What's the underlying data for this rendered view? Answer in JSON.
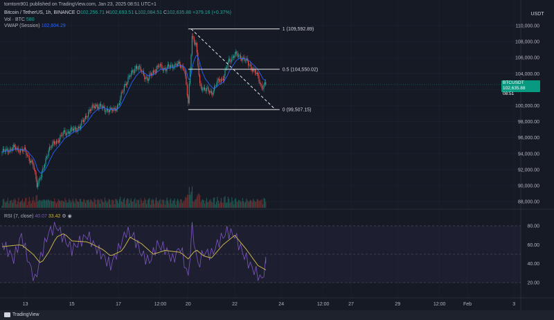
{
  "header": {
    "publisher": "tomtom901 published on TradingView.com, Jan 23, 2025 08:51 UTC+1",
    "symbol": "Bitcoin / TetherUS, 1h, BINANCE",
    "ohlc": {
      "o_label": "O",
      "o": "102,256.71",
      "h_label": "H",
      "h": "102,693.51",
      "l_label": "L",
      "l": "102,084.51",
      "c_label": "C",
      "c": "102,635.88",
      "change": "+379.16 (+0.37%)"
    },
    "vol": {
      "label": "Vol · BTC",
      "value": "580"
    },
    "vwap": {
      "label": "VWAP (Session)",
      "value": "102,604.29"
    },
    "rsi": {
      "label": "RSI (7, close)",
      "value": "40.07",
      "ma": "33.42"
    }
  },
  "currency_button": "USDT",
  "price_tag": {
    "symbol": "BTCUSDT",
    "price": "102,635.88",
    "countdown": "08:51"
  },
  "footer": {
    "brand": "TradingView"
  },
  "colors": {
    "up": "#26a69a",
    "down": "#ef5350",
    "vwap": "#2962ff",
    "rsi": "#7e57c2",
    "rsi_ma": "#c9b44a",
    "bg": "#161a25"
  },
  "chart_data": [
    {
      "type": "candlestick",
      "title": "Bitcoin / TetherUS, 1h, BINANCE",
      "ylim": [
        87000,
        111000
      ],
      "y_ticks": [
        "110,000.00",
        "108,000.00",
        "106,000.00",
        "104,000.00",
        "102,000.00",
        "100,000.00",
        "98,000.00",
        "96,000.00",
        "94,000.00",
        "92,000.00",
        "90,000.00",
        "88,000.00"
      ],
      "x_ticks": [
        "13",
        "15",
        "17",
        "12:00",
        "20",
        "22",
        "24",
        "12:00",
        "27",
        "29",
        "12:00",
        "Feb",
        "3"
      ],
      "close_path": [
        [
          "2025-01-12 00:00",
          94200
        ],
        [
          "2025-01-12 12:00",
          94700
        ],
        [
          "2025-01-13 00:00",
          94300
        ],
        [
          "2025-01-13 08:00",
          92500
        ],
        [
          "2025-01-13 12:00",
          90200
        ],
        [
          "2025-01-13 18:00",
          91800
        ],
        [
          "2025-01-14 00:00",
          94600
        ],
        [
          "2025-01-14 08:00",
          95500
        ],
        [
          "2025-01-14 16:00",
          96600
        ],
        [
          "2025-01-15 00:00",
          96900
        ],
        [
          "2025-01-15 08:00",
          97300
        ],
        [
          "2025-01-15 16:00",
          99000
        ],
        [
          "2025-01-16 00:00",
          100100
        ],
        [
          "2025-01-16 08:00",
          99700
        ],
        [
          "2025-01-16 16:00",
          99300
        ],
        [
          "2025-01-17 00:00",
          100000
        ],
        [
          "2025-01-17 06:00",
          102500
        ],
        [
          "2025-01-17 12:00",
          103700
        ],
        [
          "2025-01-17 18:00",
          104900
        ],
        [
          "2025-01-18 00:00",
          104300
        ],
        [
          "2025-01-18 06:00",
          103200
        ],
        [
          "2025-01-18 12:00",
          104300
        ],
        [
          "2025-01-18 18:00",
          104900
        ],
        [
          "2025-01-19 00:00",
          104600
        ],
        [
          "2025-01-19 12:00",
          105200
        ],
        [
          "2025-01-19 20:00",
          104700
        ],
        [
          "2025-01-20 00:00",
          100200
        ],
        [
          "2025-01-20 04:00",
          108800
        ],
        [
          "2025-01-20 08:00",
          107600
        ],
        [
          "2025-01-20 12:00",
          102500
        ],
        [
          "2025-01-20 18:00",
          102000
        ],
        [
          "2025-01-21 00:00",
          101600
        ],
        [
          "2025-01-21 06:00",
          102900
        ],
        [
          "2025-01-21 12:00",
          103500
        ],
        [
          "2025-01-21 18:00",
          105600
        ],
        [
          "2025-01-22 00:00",
          106400
        ],
        [
          "2025-01-22 08:00",
          106000
        ],
        [
          "2025-01-22 16:00",
          105000
        ],
        [
          "2025-01-23 00:00",
          103600
        ],
        [
          "2025-01-23 04:00",
          102300
        ],
        [
          "2025-01-23 08:00",
          102636
        ]
      ],
      "fibonacci": [
        {
          "label": "1 (109,592.89)",
          "level": 1,
          "price": 109592.89
        },
        {
          "label": "0.5 (104,550.02)",
          "level": 0.5,
          "price": 104550.02
        },
        {
          "label": "0 (99,507.15)",
          "level": 0,
          "price": 99507.15
        }
      ],
      "trendline": [
        [
          "2025-01-20 03:00",
          109592.89
        ],
        [
          "2025-01-23 18:00",
          99507.15
        ]
      ]
    },
    {
      "type": "line",
      "title": "RSI (7, close)",
      "ylim": [
        15,
        85
      ],
      "y_ticks": [
        "80.00",
        "60.00",
        "40.00",
        "20.00"
      ],
      "bands": [
        20,
        50,
        80
      ],
      "series": [
        {
          "name": "RSI",
          "points": [
            [
              "2025-01-12 00:00",
              62
            ],
            [
              "2025-01-12 12:00",
              45
            ],
            [
              "2025-01-12 20:00",
              70
            ],
            [
              "2025-01-13 04:00",
              40
            ],
            [
              "2025-01-13 10:00",
              22
            ],
            [
              "2025-01-13 16:00",
              48
            ],
            [
              "2025-01-14 00:00",
              73
            ],
            [
              "2025-01-14 08:00",
              80
            ],
            [
              "2025-01-14 16:00",
              66
            ],
            [
              "2025-01-15 00:00",
              55
            ],
            [
              "2025-01-15 08:00",
              63
            ],
            [
              "2025-01-15 16:00",
              70
            ],
            [
              "2025-01-16 00:00",
              58
            ],
            [
              "2025-01-16 08:00",
              48
            ],
            [
              "2025-01-16 16:00",
              38
            ],
            [
              "2025-01-17 00:00",
              55
            ],
            [
              "2025-01-17 08:00",
              74
            ],
            [
              "2025-01-17 16:00",
              68
            ],
            [
              "2025-01-18 00:00",
              50
            ],
            [
              "2025-01-18 08:00",
              42
            ],
            [
              "2025-01-18 16:00",
              60
            ],
            [
              "2025-01-19 00:00",
              56
            ],
            [
              "2025-01-19 08:00",
              44
            ],
            [
              "2025-01-19 16:00",
              58
            ],
            [
              "2025-01-20 00:00",
              25
            ],
            [
              "2025-01-20 04:00",
              78
            ],
            [
              "2025-01-20 10:00",
              38
            ],
            [
              "2025-01-20 16:00",
              52
            ],
            [
              "2025-01-21 00:00",
              50
            ],
            [
              "2025-01-21 08:00",
              64
            ],
            [
              "2025-01-21 16:00",
              74
            ],
            [
              "2025-01-22 00:00",
              70
            ],
            [
              "2025-01-22 08:00",
              52
            ],
            [
              "2025-01-22 16:00",
              38
            ],
            [
              "2025-01-23 00:00",
              28
            ],
            [
              "2025-01-23 04:00",
              23
            ],
            [
              "2025-01-23 08:00",
              40.07
            ]
          ]
        },
        {
          "name": "MA",
          "points": [
            [
              "2025-01-12 00:00",
              58
            ],
            [
              "2025-01-12 20:00",
              60
            ],
            [
              "2025-01-13 08:00",
              50
            ],
            [
              "2025-01-13 16:00",
              40
            ],
            [
              "2025-01-14 00:00",
              52
            ],
            [
              "2025-01-14 08:00",
              68
            ],
            [
              "2025-01-14 16:00",
              72
            ],
            [
              "2025-01-15 00:00",
              64
            ],
            [
              "2025-01-15 16:00",
              63
            ],
            [
              "2025-01-16 08:00",
              55
            ],
            [
              "2025-01-16 16:00",
              48
            ],
            [
              "2025-01-17 04:00",
              54
            ],
            [
              "2025-01-17 12:00",
              68
            ],
            [
              "2025-01-18 00:00",
              61
            ],
            [
              "2025-01-18 12:00",
              50
            ],
            [
              "2025-01-19 00:00",
              54
            ],
            [
              "2025-01-19 16:00",
              52
            ],
            [
              "2025-01-20 00:00",
              45
            ],
            [
              "2025-01-20 08:00",
              55
            ],
            [
              "2025-01-20 16:00",
              48
            ],
            [
              "2025-01-21 00:00",
              46
            ],
            [
              "2025-01-21 12:00",
              60
            ],
            [
              "2025-01-22 00:00",
              70
            ],
            [
              "2025-01-22 12:00",
              55
            ],
            [
              "2025-01-23 00:00",
              38
            ],
            [
              "2025-01-23 08:00",
              33.42
            ]
          ]
        }
      ]
    }
  ]
}
